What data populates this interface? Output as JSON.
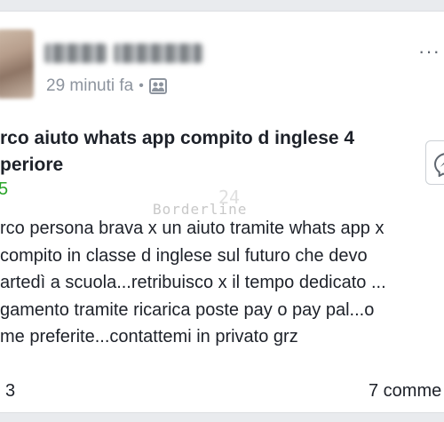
{
  "post": {
    "author_name": "Paola Johnson",
    "timestamp": "29 minuti fa",
    "separator": "•",
    "audience_icon": "group-icon",
    "more_icon": "ellipsis-icon",
    "more_label": "···",
    "title_lines": [
      "rco aiuto whats app compito d inglese 4",
      "periore"
    ],
    "price": "5",
    "message_icon": "messenger-icon",
    "watermark": "Borderline",
    "watermark_number": "24",
    "body_lines": [
      "rco persona brava x un aiuto tramite whats app x",
      "compito in classe d inglese sul futuro che devo",
      "artedì a scuola...retribuisco x il tempo dedicato ...",
      "gamento tramite ricarica poste pay o pay pal...o",
      "me preferite...contattemi in privato grz"
    ],
    "reactions_count": "3",
    "comments_label": "7 comme"
  },
  "colors": {
    "price_green": "#2aa42a",
    "meta_grey": "#8d949e",
    "text_dark": "#1d2129"
  }
}
